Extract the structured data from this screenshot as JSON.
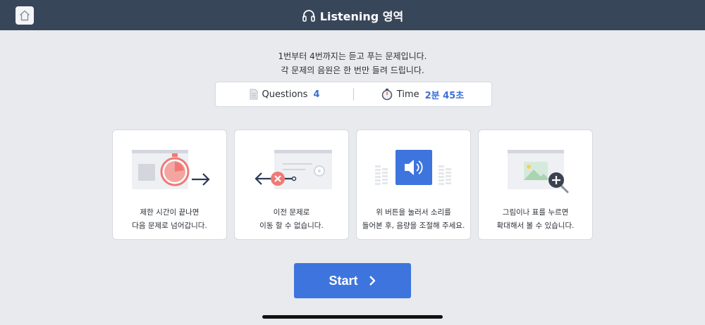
{
  "header": {
    "title": "Listening 영역",
    "home_icon": "home-icon",
    "title_icon": "headphones-icon"
  },
  "intro": {
    "line1": "1번부터 4번까지는 듣고 푸는 문제입니다.",
    "line2": "각 문제의 음원은 한 번만 들려 드립니다."
  },
  "info": {
    "questions_label": "Questions",
    "questions_value": "4",
    "time_label": "Time",
    "time_value": "2분 45초"
  },
  "cards": [
    {
      "line1": "제한 시간이 끝나면",
      "line2": "다음 문제로 넘어갑니다.",
      "icon": "timer-icon"
    },
    {
      "line1": "이전 문제로",
      "line2": "이동 할 수 없습니다.",
      "icon": "no-back-icon"
    },
    {
      "line1": "위 버튼을 눌러서 소리를",
      "line2": "들어본 후, 음량을 조절해 주세요.",
      "icon": "speaker-icon"
    },
    {
      "line1": "그림이나 표를 누르면",
      "line2": "확대해서 볼 수 있습니다.",
      "icon": "zoom-in-icon"
    }
  ],
  "start_button": {
    "label": "Start"
  },
  "colors": {
    "header_bg": "#384659",
    "accent": "#3e74dd",
    "value_blue": "#3d6fd6",
    "timer_red": "#ee7a76",
    "navy": "#2c3a55"
  }
}
